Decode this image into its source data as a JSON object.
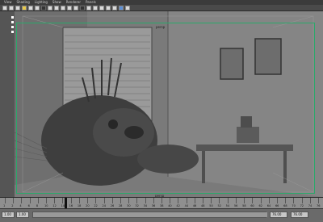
{
  "menu": {
    "items": [
      "View",
      "Shading",
      "Lighting",
      "Show",
      "Renderer",
      "Panels"
    ]
  },
  "viewport": {
    "camera_label": "persp",
    "frame_label": "persp"
  },
  "timeline": {
    "ticks": [
      "1",
      "2",
      "4",
      "6",
      "8",
      "10",
      "12",
      "14",
      "16",
      "18",
      "20",
      "22",
      "24",
      "26",
      "28",
      "30",
      "32",
      "34",
      "36",
      "38",
      "40",
      "42",
      "44",
      "46",
      "48",
      "50",
      "52",
      "54",
      "56",
      "58",
      "60",
      "62",
      "64",
      "66",
      "68",
      "70",
      "72",
      "74",
      "76"
    ],
    "current_frame": "32"
  },
  "range": {
    "start": "1.00",
    "end_start": "1.00",
    "end": "76.00",
    "end_field": "76.00"
  },
  "colors": {
    "resolution_gate": "#2aa86a",
    "viewport_bg": "#7d7d7d"
  }
}
